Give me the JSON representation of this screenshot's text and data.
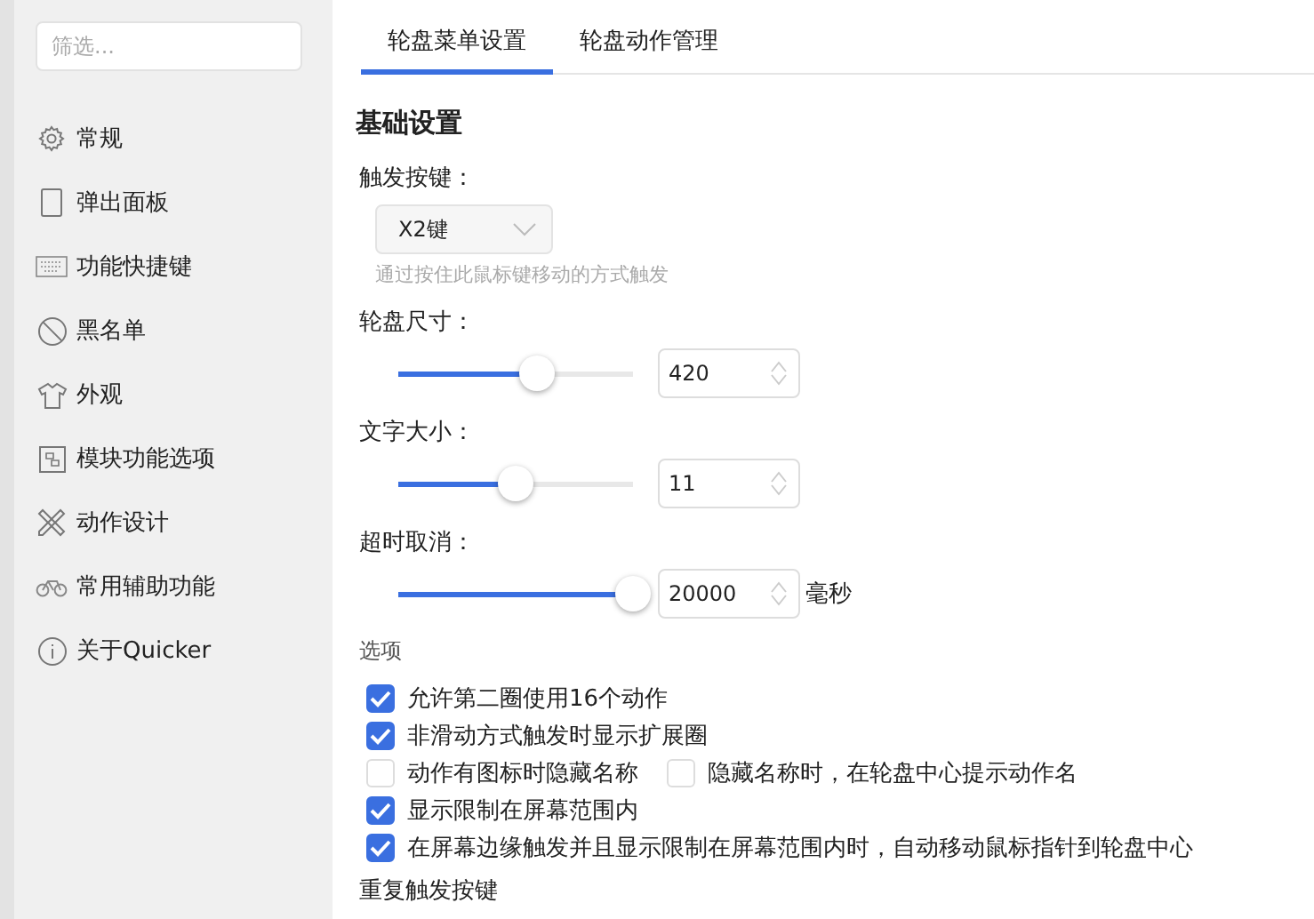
{
  "sidebar": {
    "filter": {
      "placeholder": "筛选..."
    },
    "items": [
      {
        "label": "常规"
      },
      {
        "label": "弹出面板"
      },
      {
        "label": "功能快捷键"
      },
      {
        "label": "黑名单"
      },
      {
        "label": "外观"
      },
      {
        "label": "模块功能选项"
      },
      {
        "label": "动作设计"
      },
      {
        "label": "常用辅助功能"
      },
      {
        "label": "关于Quicker"
      }
    ]
  },
  "tabs": [
    {
      "label": "轮盘菜单设置",
      "selected": true
    },
    {
      "label": "轮盘动作管理",
      "selected": false
    }
  ],
  "section_title": "基础设置",
  "trigger": {
    "label": "触发按键：",
    "value": "X2键",
    "hint": "通过按住此鼠标键移动的方式触发"
  },
  "sliders": [
    {
      "label": "轮盘尺寸：",
      "level": 0.59,
      "value": "420"
    },
    {
      "label": "文字大小：",
      "level": 0.5,
      "value": "11"
    },
    {
      "label": "超时取消：",
      "level": 1.0,
      "value": "20000",
      "unit": "毫秒"
    }
  ],
  "options": {
    "title": "选项",
    "rows": [
      [
        {
          "label": "允许第二圈使用16个动作",
          "checked": true
        }
      ],
      [
        {
          "label": "非滑动方式触发时显示扩展圈",
          "checked": true
        }
      ],
      [
        {
          "label": "动作有图标时隐藏名称",
          "checked": false
        },
        {
          "label": "隐藏名称时，在轮盘中心提示动作名",
          "checked": false
        }
      ],
      [
        {
          "label": "显示限制在屏幕范围内",
          "checked": true
        }
      ],
      [
        {
          "label": "在屏幕边缘触发并且显示限制在屏幕范围内时，自动移动鼠标指针到轮盘中心",
          "checked": true
        }
      ]
    ]
  },
  "next_section_label": "重复触发按键"
}
